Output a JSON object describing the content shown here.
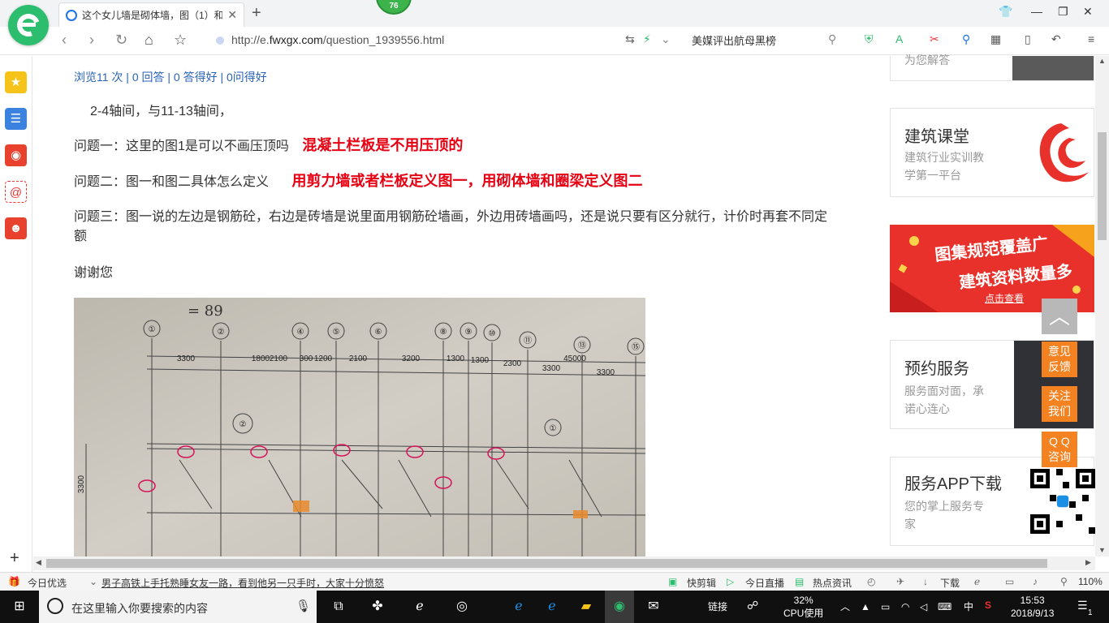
{
  "browser": {
    "tab_title": "这个女儿墙是砌体墙，图（1）和",
    "badge": "76",
    "url_prefix": "http://e.",
    "url_domain": "fwxgx.com",
    "url_path": "/question_1939556.html",
    "search_text": "美媒评出航母黑榜"
  },
  "question": {
    "stats": "浏览11 次 | 0 回答 | 0 答得好 | 0问得好",
    "line1": "2-4轴间，与11-13轴间，",
    "q1": "问题一：这里的图1是可以不画压顶吗",
    "a1": "混凝土栏板是不用压顶的",
    "q2": "问题二：图一和图二具体怎么定义",
    "a2": "用剪力墙或者栏板定义图一，用砌体墙和圈梁定义图二",
    "q3": "问题三：图一说的左边是钢筋砼，右边是砖墙是说里面用钢筋砼墙画，外边用砖墙画吗，还是说只要有区分就行，计价时再套不同定额",
    "thanks": "谢谢您"
  },
  "drawing": {
    "top_note": "= 89",
    "axes": [
      "①",
      "②",
      "④",
      "⑤",
      "⑥",
      "⑧",
      "⑨",
      "⑩",
      "⑪",
      "⑬",
      "⑮"
    ],
    "dims": [
      "3300",
      "1800",
      "2100",
      "300",
      "1200",
      "2100",
      "3200",
      "1300",
      "1300",
      "2300",
      "3300",
      "45000",
      "3300"
    ],
    "side_dim": "3300",
    "callouts": [
      "②",
      "①"
    ]
  },
  "sidebar_right": {
    "top_partial": "为您解答",
    "course_title": "建筑课堂",
    "course_desc1": "建筑行业实训教",
    "course_desc2": "学第一平台",
    "banner_line1": "图集规范覆盖广",
    "banner_line2": "建筑资料数量多",
    "banner_cta": "点击查看",
    "service_title": "预约服务",
    "service_desc1": "服务面对面，承",
    "service_desc2": "诺心连心",
    "app_title": "服务APP下载",
    "app_desc1": "您的掌上服务专",
    "app_desc2": "家"
  },
  "floating": {
    "feedback": [
      "意见",
      "反馈"
    ],
    "follow": [
      "关注",
      "我们"
    ],
    "qq": [
      "Q Q",
      "咨询"
    ]
  },
  "statusbar": {
    "today": "今日优选",
    "news": "男子高铁上手托熟睡女友一路，看到他另一只手时，大家十分愤怒",
    "kuaijian": "快剪辑",
    "live": "今日直播",
    "hot": "热点资讯",
    "download": "下载",
    "zoom": "110%"
  },
  "taskbar": {
    "search_placeholder": "在这里输入你要搜索的内容",
    "links": "链接",
    "cpu_pct": "32%",
    "cpu_label": "CPU使用",
    "ime": "中",
    "time": "15:53",
    "date": "2018/9/13",
    "notif": "1"
  },
  "colors": {
    "accent_green": "#2dbd6e",
    "link_blue": "#2a63b8",
    "answer_red": "#e60012",
    "float_orange": "#f58220"
  }
}
